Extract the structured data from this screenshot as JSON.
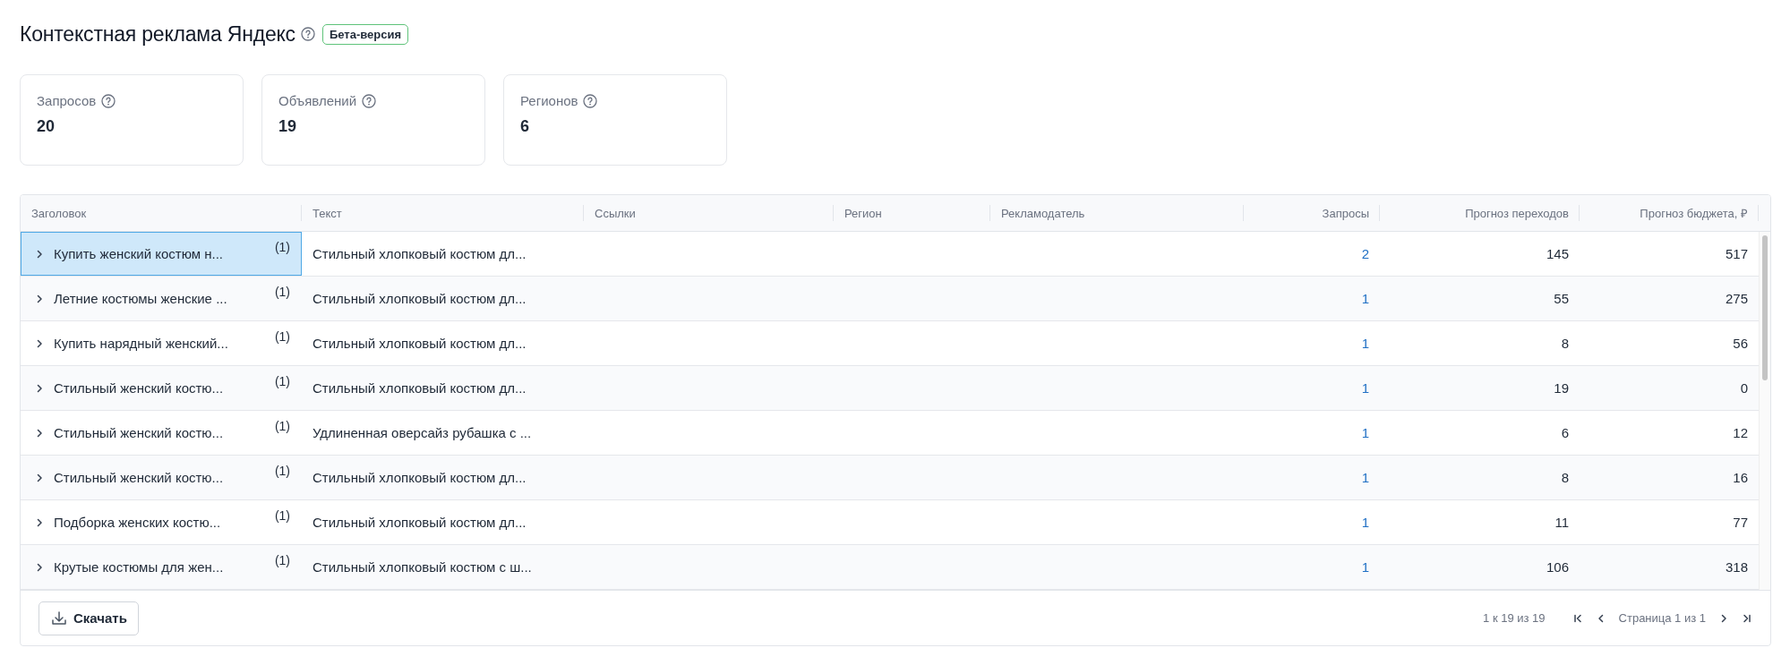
{
  "header": {
    "title": "Контекстная реклама Яндекс",
    "badge": "Бета-версия"
  },
  "stats": [
    {
      "label": "Запросов",
      "value": "20"
    },
    {
      "label": "Объявлений",
      "value": "19"
    },
    {
      "label": "Регионов",
      "value": "6"
    }
  ],
  "table": {
    "columns": [
      "Заголовок",
      "Текст",
      "Ссылки",
      "Регион",
      "Рекламодатель",
      "Запросы",
      "Прогноз переходов",
      "Прогноз бюджета, ₽"
    ],
    "rows": [
      {
        "selected": true,
        "title": "Купить женский костюм н...",
        "count": "(1)",
        "text": "Стильный хлопковый костюм дл...",
        "queries": "2",
        "clicks": "145",
        "budget": "517"
      },
      {
        "selected": false,
        "title": "Летние костюмы женские ...",
        "count": "(1)",
        "text": "Стильный хлопковый костюм дл...",
        "queries": "1",
        "clicks": "55",
        "budget": "275"
      },
      {
        "selected": false,
        "title": "Купить нарядный женский...",
        "count": "(1)",
        "text": "Стильный хлопковый костюм дл...",
        "queries": "1",
        "clicks": "8",
        "budget": "56"
      },
      {
        "selected": false,
        "title": "Стильный женский костю...",
        "count": "(1)",
        "text": "Стильный хлопковый костюм дл...",
        "queries": "1",
        "clicks": "19",
        "budget": "0"
      },
      {
        "selected": false,
        "title": "Стильный женский костю...",
        "count": "(1)",
        "text": "Удлиненная оверсайз рубашка с ...",
        "queries": "1",
        "clicks": "6",
        "budget": "12"
      },
      {
        "selected": false,
        "title": "Стильный женский костю...",
        "count": "(1)",
        "text": "Стильный хлопковый костюм дл...",
        "queries": "1",
        "clicks": "8",
        "budget": "16"
      },
      {
        "selected": false,
        "title": "Подборка женских костю...",
        "count": "(1)",
        "text": "Стильный хлопковый костюм дл...",
        "queries": "1",
        "clicks": "11",
        "budget": "77"
      },
      {
        "selected": false,
        "title": "Крутые костюмы для жен...",
        "count": "(1)",
        "text": "Стильный хлопковый костюм с ш...",
        "queries": "1",
        "clicks": "106",
        "budget": "318"
      }
    ]
  },
  "footer": {
    "download": "Скачать",
    "range": "1 к 19 из 19",
    "page": "Страница 1 из 1"
  }
}
